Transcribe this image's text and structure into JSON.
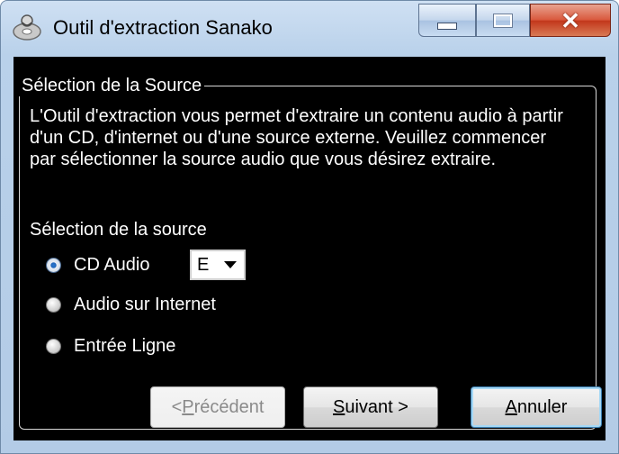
{
  "window": {
    "title": "Outil d'extraction Sanako",
    "controls": {
      "minimize": "minimize",
      "maximize": "maximize",
      "close": "close"
    }
  },
  "group": {
    "legend": "Sélection de la Source",
    "description": "L'Outil d'extraction vous permet d'extraire un contenu audio à partir d'un CD, d'internet ou d'une source externe. Veuillez commencer par sélectionner la source audio que vous désirez extraire.",
    "source_label": "Sélection de la source"
  },
  "options": [
    {
      "label": "CD Audio",
      "checked": true
    },
    {
      "label": "Audio sur Internet",
      "checked": false
    },
    {
      "label": "Entrée Ligne",
      "checked": false
    }
  ],
  "drive_select": {
    "value": "E"
  },
  "buttons": {
    "prev": {
      "mnemonic": "P",
      "rest": "récédent",
      "prefix": "< ",
      "enabled": false
    },
    "next": {
      "mnemonic": "S",
      "rest": "uivant >",
      "prefix": ""
    },
    "cancel": {
      "mnemonic": "A",
      "rest": "nnuler",
      "prefix": ""
    }
  },
  "icons": [
    "cd-extraction-icon",
    "minimize-icon",
    "maximize-icon",
    "close-icon",
    "chevron-down-icon"
  ],
  "colors": {
    "client_background": "#000000",
    "title_bar": "#b9d1ea",
    "close_button": "#c2361a"
  }
}
